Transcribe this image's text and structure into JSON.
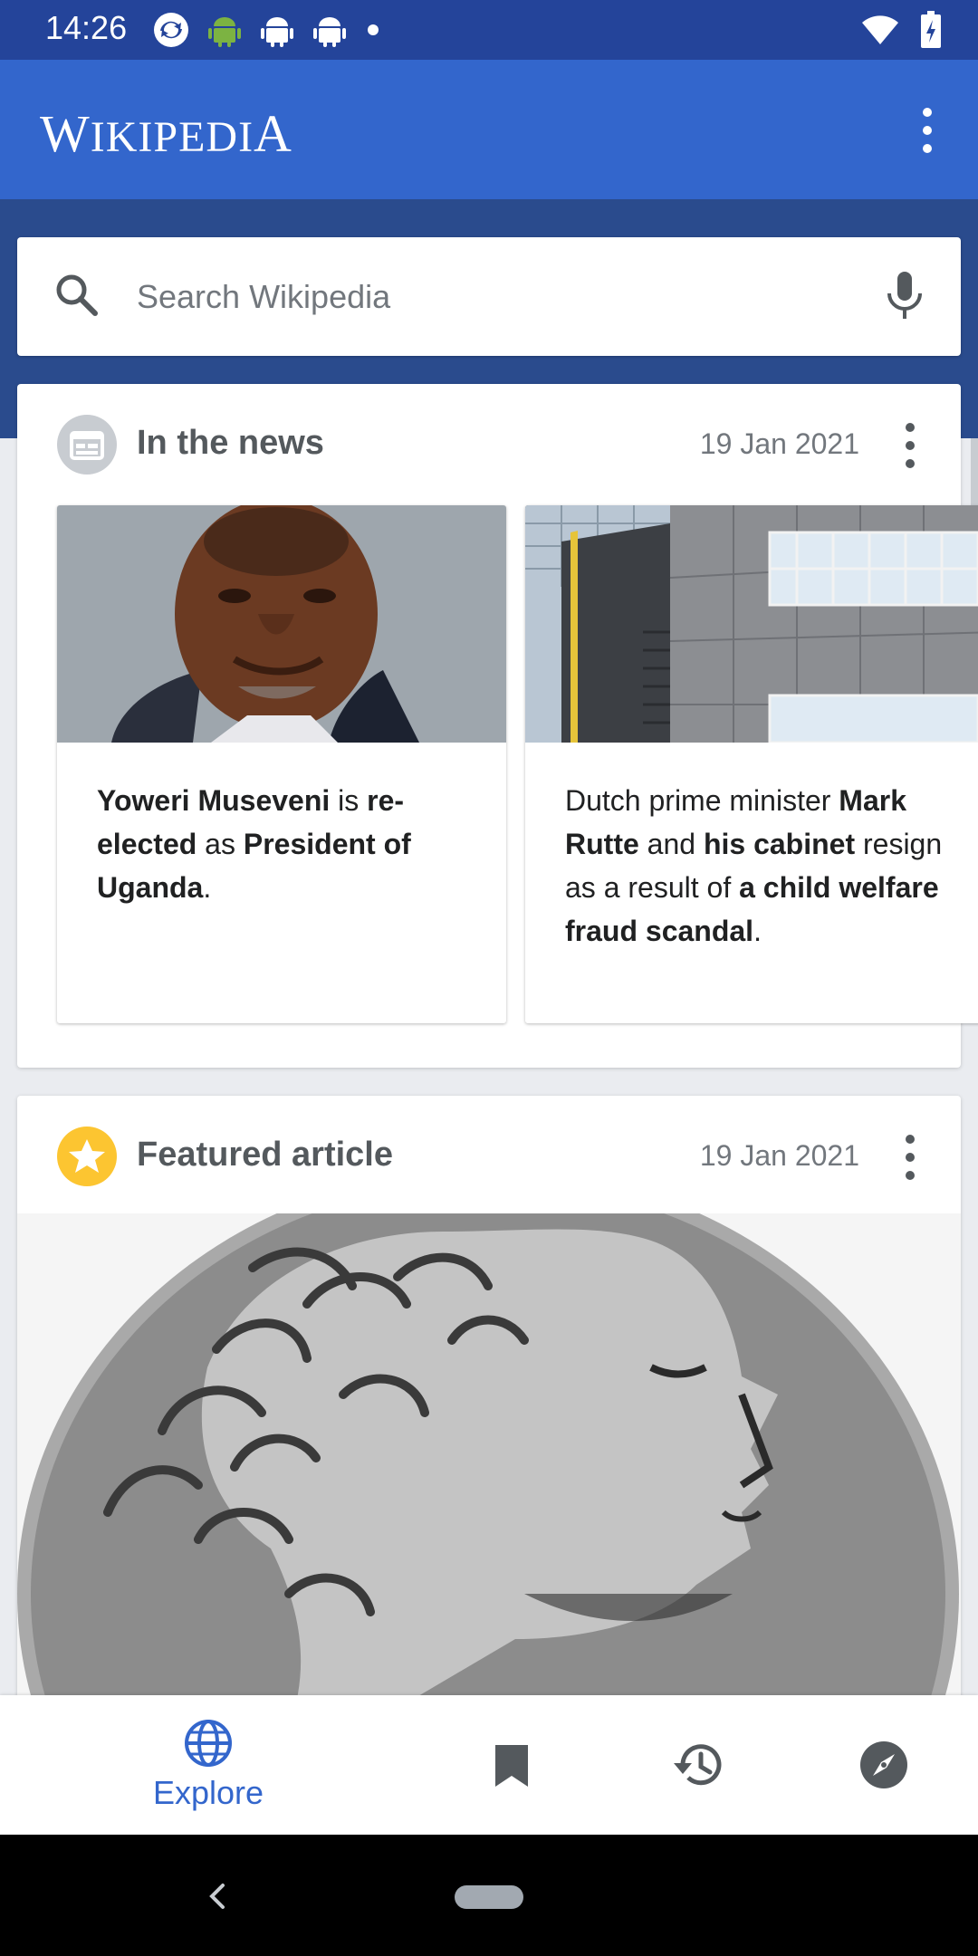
{
  "status": {
    "time": "14:26"
  },
  "app": {
    "logo_first": "W",
    "logo_middle": "IKIPEDI",
    "logo_last": "A"
  },
  "search": {
    "placeholder": "Search Wikipedia"
  },
  "news_card": {
    "title": "In the news",
    "date": "19 Jan 2021",
    "items": [
      {
        "parts": [
          [
            "Yoweri Museveni",
            true
          ],
          [
            " is ",
            false
          ],
          [
            "re-elected",
            true
          ],
          [
            " as ",
            false
          ],
          [
            "President of Uganda",
            true
          ],
          [
            ".",
            false
          ]
        ]
      },
      {
        "parts": [
          [
            "Dutch prime minister ",
            false
          ],
          [
            "Mark Rutte",
            true
          ],
          [
            " and ",
            false
          ],
          [
            "his cabinet",
            true
          ],
          [
            " resign as a result of ",
            false
          ],
          [
            "a child welfare fraud scandal",
            true
          ],
          [
            ".",
            false
          ]
        ]
      }
    ]
  },
  "featured_card": {
    "title": "Featured article",
    "date": "19 Jan 2021"
  },
  "bottom_nav": {
    "explore_label": "Explore"
  },
  "colors": {
    "accent": "#3366cc",
    "app_bar": "#3366cc",
    "status_bar": "#24449a",
    "featured_icon": "#fcc531"
  },
  "icons": [
    "search-icon",
    "mic-icon",
    "calendar-icon",
    "star-icon",
    "globe-icon",
    "bookmark-icon",
    "history-icon",
    "compass-icon",
    "more-vert-icon",
    "back-icon"
  ]
}
